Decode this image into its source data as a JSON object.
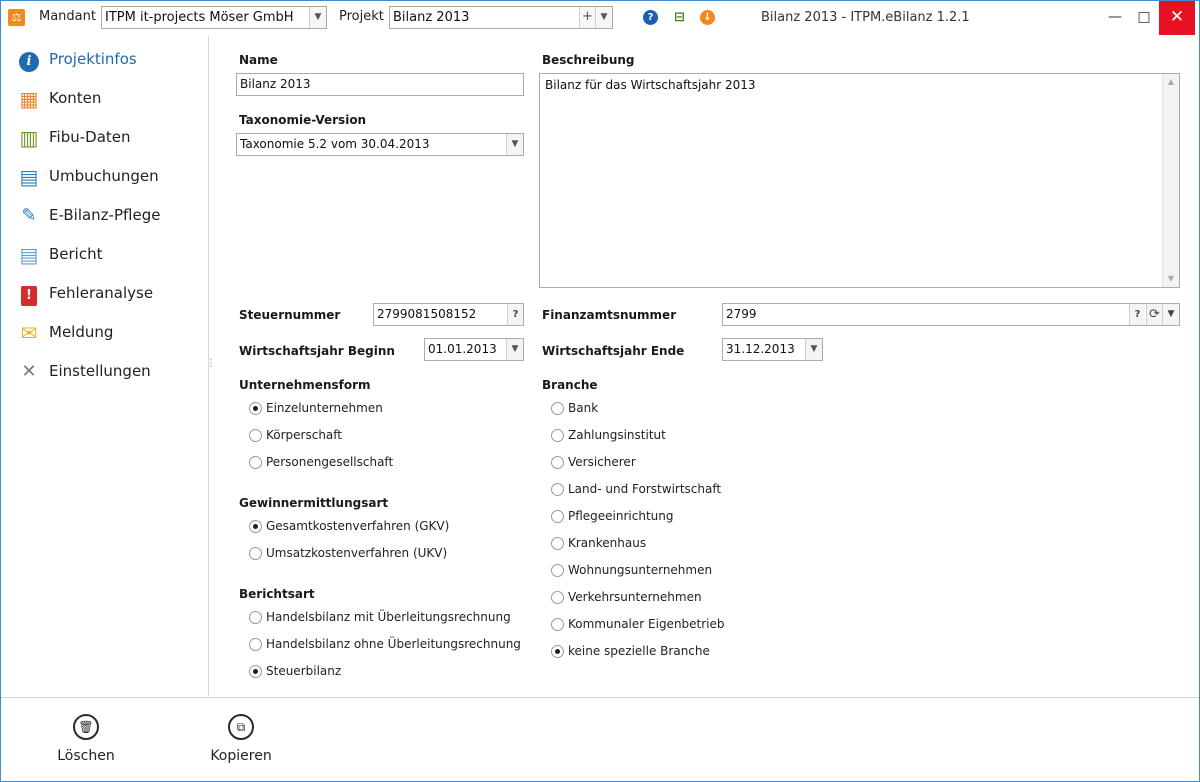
{
  "titlebar": {
    "logo": "⚖",
    "mandant_label": "Mandant",
    "mandant_value": "ITPM it-projects Möser GmbH",
    "projekt_label": "Projekt",
    "projekt_value": "Bilanz 2013",
    "plus": "+",
    "window_title": "Bilanz 2013 - ITPM.eBilanz 1.2.1",
    "help_glyph": "?",
    "network_glyph": "⊟",
    "download_glyph": "↓",
    "minimize": "—",
    "maximize": "□",
    "close": "✕",
    "icons": {
      "help": "help-icon",
      "network": "network-icon",
      "download": "download-icon"
    }
  },
  "sidebar": {
    "grip": "⋮",
    "items": [
      {
        "label": "Projektinfos",
        "icon": "info-icon",
        "glyph": "i",
        "color": "#1f6ab0",
        "active": true
      },
      {
        "label": "Konten",
        "icon": "table-icon",
        "glyph": "▦",
        "color": "#e8862a",
        "active": false
      },
      {
        "label": "Fibu-Daten",
        "icon": "books-icon",
        "glyph": "▥",
        "color": "#6a9a2a",
        "active": false
      },
      {
        "label": "Umbuchungen",
        "icon": "open-book-icon",
        "glyph": "▤",
        "color": "#2e7fb8",
        "active": false
      },
      {
        "label": "E-Bilanz-Pflege",
        "icon": "edit-document-icon",
        "glyph": "✎",
        "color": "#2e7fb8",
        "active": false
      },
      {
        "label": "Bericht",
        "icon": "report-icon",
        "glyph": "▤",
        "color": "#5aa0d8",
        "active": false
      },
      {
        "label": "Fehleranalyse",
        "icon": "error-icon",
        "glyph": "!",
        "color": "#d62a2a",
        "active": false
      },
      {
        "label": "Meldung",
        "icon": "mail-icon",
        "glyph": "✉",
        "color": "#e8b22a",
        "active": false
      },
      {
        "label": "Einstellungen",
        "icon": "tools-icon",
        "glyph": "✕",
        "color": "#777777",
        "active": false
      }
    ]
  },
  "form": {
    "name_label": "Name",
    "name_value": "Bilanz 2013",
    "taxonomie_label": "Taxonomie-Version",
    "taxonomie_value": "Taxonomie 5.2 vom 30.04.2013",
    "beschreibung_label": "Beschreibung",
    "beschreibung_value": "Bilanz für das Wirtschaftsjahr 2013",
    "steuernummer_label": "Steuernummer",
    "steuernummer_value": "2799081508152",
    "finanzamt_label": "Finanzamtsnummer",
    "finanzamt_value": "2799",
    "wj_beginn_label": "Wirtschaftsjahr Beginn",
    "wj_beginn_value": "01.01.2013",
    "wj_ende_label": "Wirtschaftsjahr Ende",
    "wj_ende_value": "31.12.2013",
    "question": "?",
    "refresh_glyph": "⟳",
    "arrow_glyph": "▼",
    "up_glyph": "▲",
    "unternehmensform_label": "Unternehmensform",
    "unternehmensform_options": [
      {
        "label": "Einzelunternehmen",
        "checked": true
      },
      {
        "label": "Körperschaft",
        "checked": false
      },
      {
        "label": "Personengesellschaft",
        "checked": false
      }
    ],
    "gewinn_label": "Gewinnermittlungsart",
    "gewinn_options": [
      {
        "label": "Gesamtkostenverfahren (GKV)",
        "checked": true
      },
      {
        "label": "Umsatzkostenverfahren (UKV)",
        "checked": false
      }
    ],
    "berichtsart_label": "Berichtsart",
    "berichtsart_options": [
      {
        "label": "Handelsbilanz mit Überleitungsrechnung",
        "checked": false
      },
      {
        "label": "Handelsbilanz ohne Überleitungsrechnung",
        "checked": false
      },
      {
        "label": "Steuerbilanz",
        "checked": true
      }
    ],
    "branche_label": "Branche",
    "branche_options": [
      {
        "label": "Bank",
        "checked": false
      },
      {
        "label": "Zahlungsinstitut",
        "checked": false
      },
      {
        "label": "Versicherer",
        "checked": false
      },
      {
        "label": "Land- und Forstwirtschaft",
        "checked": false
      },
      {
        "label": "Pflegeeinrichtung",
        "checked": false
      },
      {
        "label": "Krankenhaus",
        "checked": false
      },
      {
        "label": "Wohnungsunternehmen",
        "checked": false
      },
      {
        "label": "Verkehrsunternehmen",
        "checked": false
      },
      {
        "label": "Kommunaler Eigenbetrieb",
        "checked": false
      },
      {
        "label": "keine spezielle Branche",
        "checked": true
      }
    ]
  },
  "actions": {
    "delete_label": "Löschen",
    "delete_glyph": "🗑",
    "copy_label": "Kopieren",
    "copy_glyph": "⧉"
  }
}
